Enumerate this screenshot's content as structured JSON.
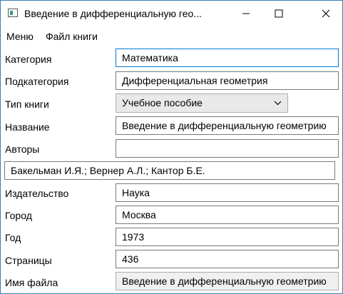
{
  "window": {
    "title": "Введение в дифференциальную гео...",
    "icons": {
      "app": "app-window-icon",
      "minimize": "minimize-icon",
      "maximize": "maximize-icon",
      "close": "close-icon"
    }
  },
  "menu": [
    "Меню",
    "Файл книги"
  ],
  "form": {
    "category_label": "Категория",
    "category_value": "Математика",
    "subcategory_label": "Подкатегория",
    "subcategory_value": "Дифференциальная геометрия",
    "book_type_label": "Тип книги",
    "book_type_value": "Учебное пособие",
    "title_label": "Название",
    "title_value": "Введение в дифференциальную геометрию",
    "authors_label": "Авторы",
    "authors_input_value": "",
    "authors_value": "Бакельман И.Я.; Вернер А.Л.; Кантор Б.Е.",
    "publisher_label": "Издательство",
    "publisher_value": "Наука",
    "city_label": "Город",
    "city_value": "Москва",
    "year_label": "Год",
    "year_value": "1973",
    "pages_label": "Страницы",
    "pages_value": "436",
    "filename_label": "Имя файла",
    "filename_value": "Введение в дифференциальную геометрию"
  },
  "colors": {
    "window_border": "#3c7fb1",
    "focus_border": "#0078d7",
    "app_icon_accent": "#2f9a8d"
  }
}
